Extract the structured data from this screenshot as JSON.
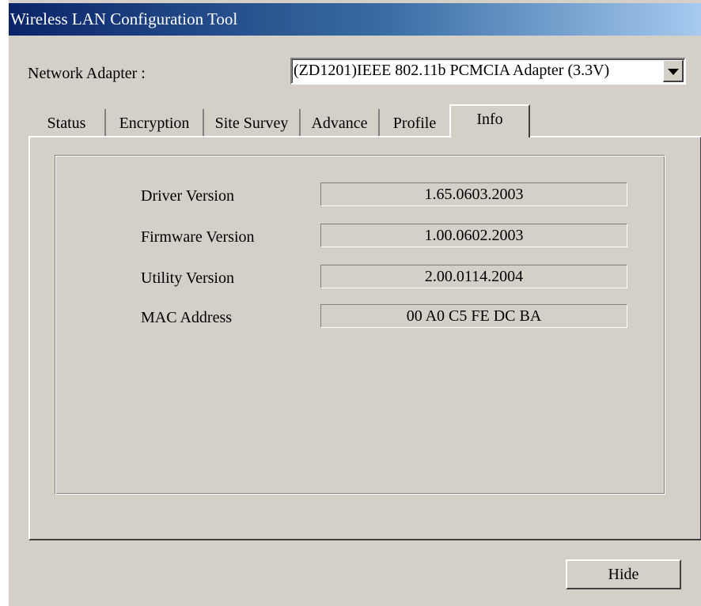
{
  "window": {
    "title": "Wireless LAN Configuration Tool"
  },
  "adapter": {
    "label": "Network Adapter :",
    "selected": "(ZD1201)IEEE 802.11b PCMCIA Adapter (3.3V)"
  },
  "tabs": [
    {
      "label": "Status",
      "active": false
    },
    {
      "label": "Encryption",
      "active": false
    },
    {
      "label": "Site Survey",
      "active": false
    },
    {
      "label": "Advance",
      "active": false
    },
    {
      "label": "Profile",
      "active": false
    },
    {
      "label": "Info",
      "active": true
    }
  ],
  "info": {
    "rows": [
      {
        "label": "Driver Version",
        "value": "1.65.0603.2003"
      },
      {
        "label": "Firmware Version",
        "value": "1.00.0602.2003"
      },
      {
        "label": "Utility Version",
        "value": "2.00.0114.2004"
      },
      {
        "label": "MAC Address",
        "value": "00 A0 C5 FE DC BA"
      }
    ]
  },
  "buttons": {
    "hide": "Hide"
  }
}
